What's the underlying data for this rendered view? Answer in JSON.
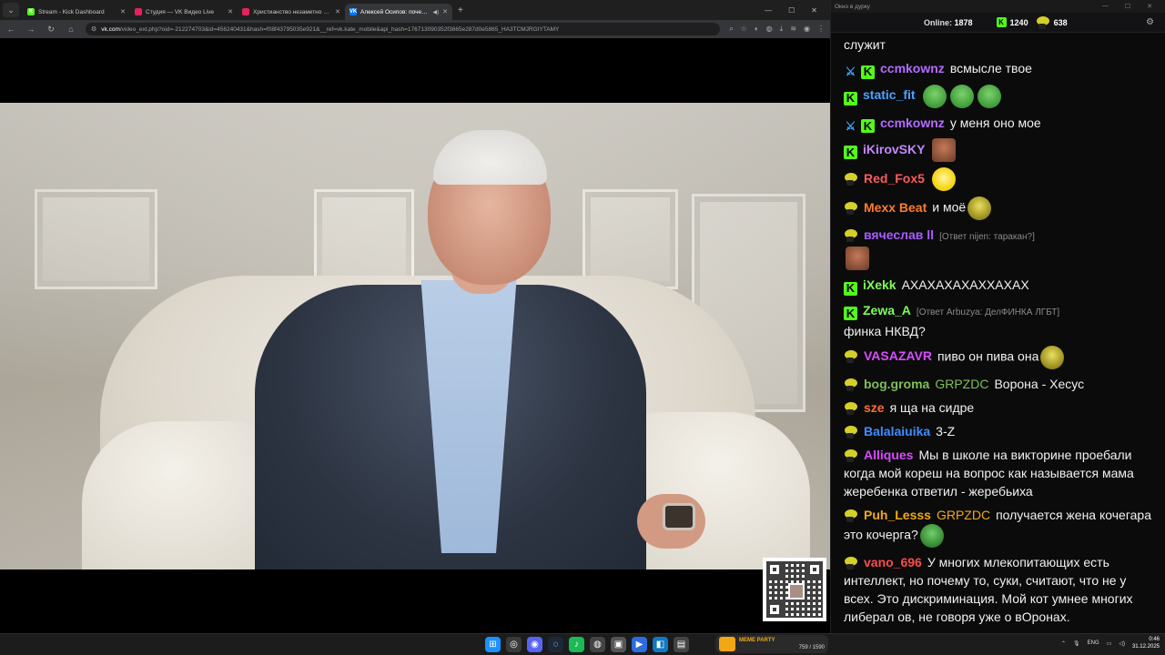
{
  "browser": {
    "tabs": [
      {
        "title": "Stream - Kick Dashboard",
        "favicon_color": "#53fc18",
        "favicon_letter": "K",
        "active": false
      },
      {
        "title": "Студия — VK Видео Live",
        "favicon_color": "#e0245e",
        "favicon_letter": "",
        "active": false
      },
      {
        "title": "Христианство незаметно уход...",
        "favicon_color": "#e0245e",
        "favicon_letter": "",
        "active": false
      },
      {
        "title": "Алексей Осипов: почему Б...",
        "favicon_color": "#0077ff",
        "favicon_letter": "VK",
        "active": true
      }
    ],
    "url_host": "vk.com",
    "url_path": "/video_ext.php?oid=-212274703&id=456240431&hash=f08f43795035e921&__ref=vk.kate_mobile&api_hash=176713090352f3665e287d0e5865_HA3TCMJRGIYTAMY"
  },
  "chat": {
    "window_title": "Окно в дурку",
    "online_label": "Online:",
    "online_count": "1878",
    "kick_count": "1240",
    "pepe_count": "638",
    "messages": [
      {
        "badges": [],
        "user": "",
        "user_color": "#fff",
        "text": "служит",
        "emotes": []
      },
      {
        "badges": [
          "sword",
          "kick"
        ],
        "user": "ccmkownz",
        "user_color": "#b36bff",
        "text": "всмысле твое",
        "emotes": []
      },
      {
        "badges": [
          "kick"
        ],
        "user": "static_fit",
        "user_color": "#4aa3ff",
        "text": "",
        "emotes": [
          "pepe-grin",
          "pepe-grin",
          "pepe-grin"
        ]
      },
      {
        "badges": [
          "sword",
          "kick"
        ],
        "user": "ccmkownz",
        "user_color": "#b36bff",
        "text": "у меня оно мое",
        "emotes": []
      },
      {
        "badges": [
          "kick"
        ],
        "user": "iKirovSKY",
        "user_color": "#c488ff",
        "text": "",
        "emotes": [
          "face"
        ]
      },
      {
        "badges": [
          "pepe"
        ],
        "user": "Red_Fox5",
        "user_color": "#ff5a5a",
        "text": "",
        "emotes": [
          "troll"
        ]
      },
      {
        "badges": [
          "pepe"
        ],
        "user": "Mexx Beat",
        "user_color": "#ff7a2e",
        "text": "и моё",
        "emotes": [
          "yellow"
        ]
      },
      {
        "badges": [
          "pepe"
        ],
        "user": "вячеслав ll",
        "user_color": "#a65cff",
        "reply": "[Ответ nijen: таракан?]",
        "text": "",
        "emotes": [
          "face"
        ]
      },
      {
        "badges": [
          "kick"
        ],
        "user": "iXekk",
        "user_color": "#7bff5a",
        "text": "АХАХАХАХАХХАХАХ",
        "emotes": []
      },
      {
        "badges": [
          "kick"
        ],
        "user": "Zewa_A",
        "user_color": "#7bff5a",
        "reply": "[Ответ Arbuzya: ДелФИНКА ЛГБТ]",
        "text": "финка НКВД?",
        "emotes": []
      },
      {
        "badges": [
          "pepe"
        ],
        "user": "VASAZAVR",
        "user_color": "#d94cff",
        "text": "пиво он пива она",
        "emotes": [
          "yellow"
        ]
      },
      {
        "badges": [
          "pepe"
        ],
        "user": "bog.groma",
        "user_color": "#7fbf5a",
        "user2": "GRPZDC",
        "user2_color": "#7fbf5a",
        "text": "Ворона - Хесус",
        "emotes": []
      },
      {
        "badges": [
          "pepe"
        ],
        "user": "sze",
        "user_color": "#ff6a3a",
        "text": "я ща на сидре",
        "emotes": []
      },
      {
        "badges": [
          "pepe"
        ],
        "user": "Balalaiuika",
        "user_color": "#3f8cff",
        "text": "3-Z",
        "emotes": []
      },
      {
        "badges": [
          "pepe"
        ],
        "user": "Alliques",
        "user_color": "#d94cff",
        "text": "Мы в школе на викторине проебали когда мой кореш на вопрос как называется мама жеребенка ответил - жеребьиха",
        "emotes": []
      },
      {
        "badges": [
          "pepe"
        ],
        "user": "Puh_Lesss",
        "user_color": "#f2a814",
        "user2": "GRPZDC",
        "user2_color": "#f2a814",
        "text": "получается жена кочегара это кочерга?",
        "emotes": [
          "frog"
        ]
      },
      {
        "badges": [
          "pepe"
        ],
        "user": "vano_696",
        "user_color": "#ff4a4a",
        "text": "У многих млекопитающих есть интеллект, но почему то, суки, считают, что не у всех. Это дискриминация. Мой кот умнее многих либерал ов, не говоря уже о вОронах.",
        "emotes": []
      }
    ]
  },
  "taskbar": {
    "widget_title": "МЕМЕ PARTY",
    "widget_count": "759 / 1590",
    "lang": "ENG",
    "time": "0:46",
    "date": "31.12.2025"
  }
}
